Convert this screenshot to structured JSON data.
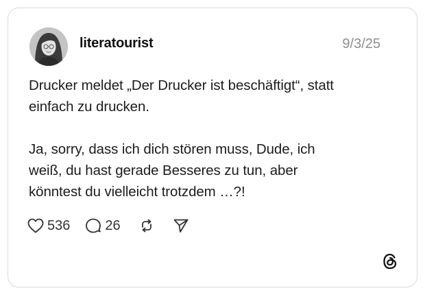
{
  "post": {
    "username": "literatourist",
    "date": "9/3/25",
    "paragraphs": [
      "Drucker meldet „Der Drucker ist beschäftigt“, statt\neinfach zu drucken.",
      "Ja, sorry, dass ich dich stören muss, Dude, ich\nweiß, du hast gerade Besseres zu tun, aber\nkönntest du vielleicht trotzdem …?!"
    ],
    "likes": "536",
    "replies": "26"
  },
  "icons": {
    "like": "heart-icon",
    "reply": "speech-bubble-icon",
    "repost": "repost-icon",
    "share": "send-icon",
    "brand": "threads-logo-icon"
  },
  "colors": {
    "text": "#1c1c1c",
    "muted": "#8e8e8e",
    "border": "#d9d9d9"
  }
}
